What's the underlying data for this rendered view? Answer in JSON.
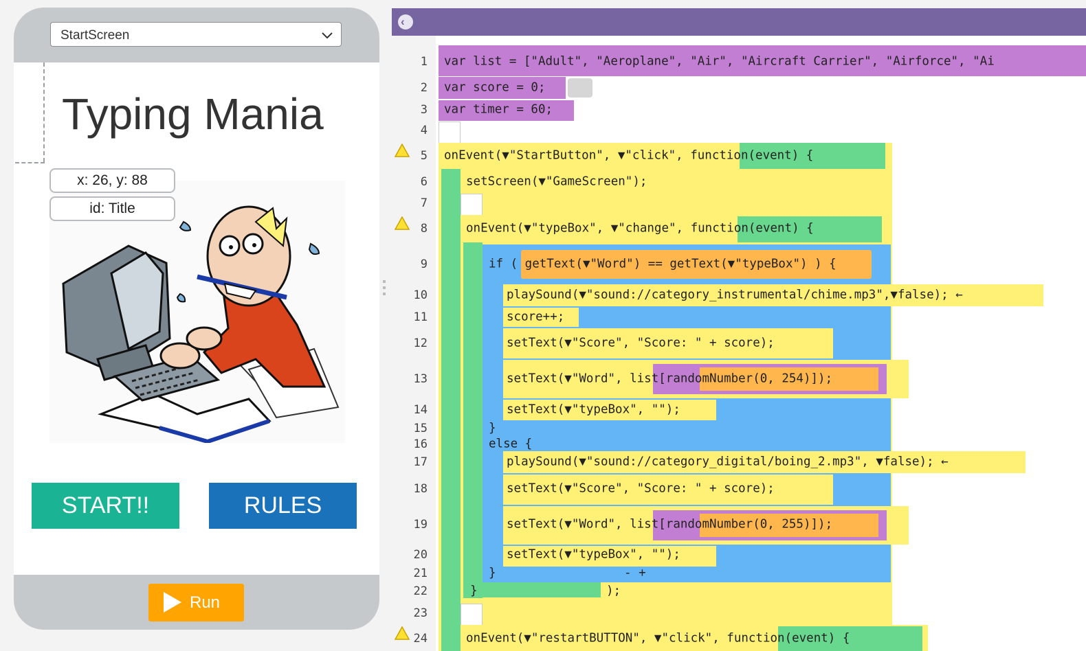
{
  "screen_selector": {
    "value": "StartScreen",
    "icon": "chevron-down-icon"
  },
  "app": {
    "title": "Typing Mania",
    "tooltip_position": "x: 26, y: 88",
    "tooltip_id": "id: Title",
    "illustration": "typing-man-at-computer",
    "start_button": "START!!",
    "rules_button": "RULES"
  },
  "run_button": {
    "label": "Run",
    "icon": "play-icon",
    "color": "#ffa400"
  },
  "editor": {
    "header_color": "#7665a0",
    "collapse_icon": "chevron-left-icon",
    "line_numbers": [
      "1",
      "2",
      "3",
      "4",
      "5",
      "6",
      "7",
      "8",
      "9",
      "10",
      "11",
      "12",
      "13",
      "14",
      "15",
      "16",
      "17",
      "18",
      "19",
      "20",
      "21",
      "22",
      "23",
      "24"
    ],
    "warning_lines": [
      "5",
      "8",
      "24"
    ],
    "colors": {
      "variables": "#c27ed3",
      "events": "#fff176",
      "functions": "#68d88e",
      "logic": "#64b5f6",
      "math": "#ffb74d"
    },
    "lines": {
      "l1": "var list = [\"Adult\", \"Aeroplane\", \"Air\", \"Aircraft Carrier\", \"Airforce\", \"Ai",
      "l2": "var score = 0;",
      "l3": "var timer = 60;",
      "l5": "onEvent(▼\"StartButton\", ▼\"click\", function(event) {",
      "l6": "setScreen(▼\"GameScreen\");",
      "l8": "onEvent(▼\"typeBox\", ▼\"change\", function(event) {",
      "l9": "if ( getText(▼\"Word\") == getText(▼\"typeBox\") ) {",
      "l10": "playSound(▼\"sound://category_instrumental/chime.mp3\",▼false); ←",
      "l11": "score++;",
      "l12": "setText(▼\"Score\", \"Score: \" + score);",
      "l13": "setText(▼\"Word\", list[randomNumber(0, 254)]);",
      "l14": "setText(▼\"typeBox\", \"\");",
      "l15": "}",
      "l16": "else {",
      "l17": "playSound(▼\"sound://category_digital/boing_2.mp3\", ▼false); ←",
      "l18": "setText(▼\"Score\", \"Score: \" + score);",
      "l19": "setText(▼\"Word\", list[randomNumber(0, 255)]);",
      "l20": "setText(▼\"typeBox\", \"\");",
      "l21": "}",
      "l21_buttons": "- +",
      "l22a": "}",
      "l22b": ");",
      "l24": "onEvent(▼\"restartBUTTON\", ▼\"click\", function(event) {"
    }
  }
}
